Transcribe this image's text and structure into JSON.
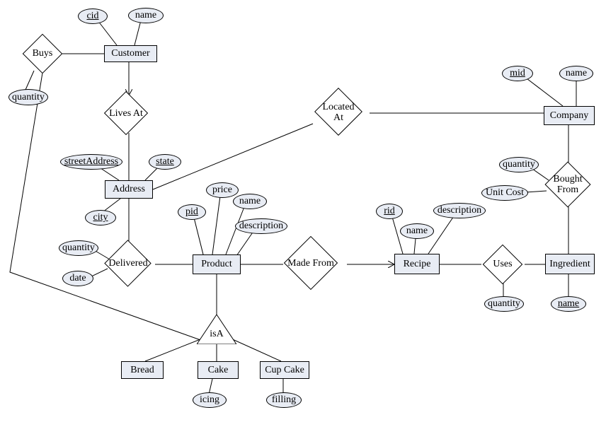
{
  "entities": {
    "customer": "Customer",
    "address": "Address",
    "product": "Product",
    "recipe": "Recipe",
    "ingredient": "Ingredient",
    "company": "Company",
    "bread": "Bread",
    "cake": "Cake",
    "cupcake": "Cup Cake"
  },
  "attributes": {
    "cid": "cid",
    "cust_name": "name",
    "streetAddress": "streetAddress",
    "state": "state",
    "city": "city",
    "quantity_buys": "quantity",
    "quantity_deliv": "quantity",
    "date_deliv": "date",
    "pid": "pid",
    "price": "price",
    "prod_name": "name",
    "description_prod": "description",
    "rid": "rid",
    "recipe_name": "name",
    "description_recipe": "description",
    "quantity_uses": "quantity",
    "ing_name": "name",
    "mid": "mid",
    "comp_name": "name",
    "quantity_bought": "quantity",
    "unit_cost": "Unit Cost",
    "icing": "icing",
    "filling": "filling"
  },
  "relationships": {
    "buys": "Buys",
    "lives_at": "Lives At",
    "located_at": "Located\nAt",
    "delivered": "Delivered",
    "made_from": "Made From",
    "uses": "Uses",
    "bought_from": "Bought\nFrom",
    "isa": "isA"
  },
  "chart_data": {
    "type": "er-diagram",
    "entities": [
      {
        "name": "Customer",
        "attributes": [
          {
            "name": "cid",
            "key": true
          },
          {
            "name": "name"
          }
        ]
      },
      {
        "name": "Address",
        "attributes": [
          {
            "name": "streetAddress",
            "key": true
          },
          {
            "name": "state",
            "key": true
          },
          {
            "name": "city",
            "key": true
          }
        ]
      },
      {
        "name": "Product",
        "attributes": [
          {
            "name": "pid",
            "key": true
          },
          {
            "name": "price"
          },
          {
            "name": "name"
          },
          {
            "name": "description"
          }
        ]
      },
      {
        "name": "Recipe",
        "attributes": [
          {
            "name": "rid",
            "key": true
          },
          {
            "name": "name"
          },
          {
            "name": "description"
          }
        ]
      },
      {
        "name": "Ingredient",
        "attributes": [
          {
            "name": "name",
            "key": true
          }
        ]
      },
      {
        "name": "Company",
        "attributes": [
          {
            "name": "mid",
            "key": true
          },
          {
            "name": "name"
          }
        ]
      },
      {
        "name": "Bread"
      },
      {
        "name": "Cake",
        "attributes": [
          {
            "name": "icing"
          }
        ]
      },
      {
        "name": "Cup Cake",
        "attributes": [
          {
            "name": "filling"
          }
        ]
      }
    ],
    "relationships": [
      {
        "name": "Buys",
        "between": [
          "Customer",
          "Product"
        ],
        "attributes": [
          {
            "name": "quantity"
          }
        ]
      },
      {
        "name": "Lives At",
        "between": [
          "Customer",
          "Address"
        ],
        "total_participation": [
          "Customer"
        ]
      },
      {
        "name": "Located At",
        "between": [
          "Address",
          "Company"
        ]
      },
      {
        "name": "Delivered",
        "between": [
          "Address",
          "Product"
        ],
        "attributes": [
          {
            "name": "quantity"
          },
          {
            "name": "date"
          }
        ]
      },
      {
        "name": "Made From",
        "between": [
          "Product",
          "Recipe"
        ],
        "arrow_to": "Recipe",
        "total_participation": [
          "Product"
        ]
      },
      {
        "name": "Uses",
        "between": [
          "Recipe",
          "Ingredient"
        ],
        "attributes": [
          {
            "name": "quantity"
          }
        ],
        "total_participation": [
          "Recipe"
        ]
      },
      {
        "name": "Bought From",
        "between": [
          "Company",
          "Ingredient"
        ],
        "attributes": [
          {
            "name": "quantity"
          },
          {
            "name": "Unit Cost"
          }
        ]
      }
    ],
    "isa": {
      "parent": "Product",
      "children": [
        "Bread",
        "Cake",
        "Cup Cake"
      ]
    }
  }
}
